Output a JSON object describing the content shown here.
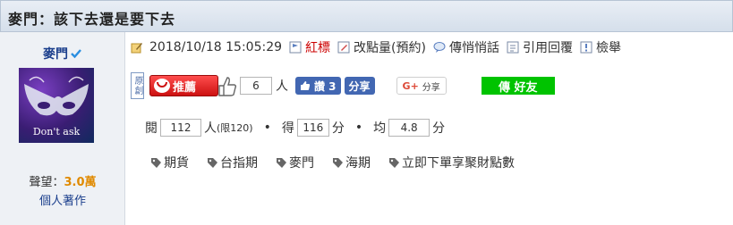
{
  "thread": {
    "title": "麥門：該下去還是要下去"
  },
  "author": {
    "name": "麥門",
    "avatar_caption": "Don't ask",
    "prestige_label": "聲望：",
    "prestige_value": "3.0萬",
    "works_link": "個人著作"
  },
  "post_meta": {
    "datetime": "2018/10/18 15:05:29",
    "actions": [
      "紅標",
      "改點量(預約)",
      "傳悄悄話",
      "引用回覆",
      "檢舉"
    ]
  },
  "buttons": {
    "original_label": "原創",
    "recommend_label": "推薦",
    "recommend_count": "6",
    "recommend_unit": "人",
    "fb_like_label": "讚 3",
    "fb_share_label": "分享",
    "g_share_label": "分享",
    "line_share_label": "傳 好友"
  },
  "stats": {
    "read_label": "閱",
    "read_value": "112",
    "read_unit": "人",
    "read_limit": "(限120)",
    "score_label": "得",
    "score_value": "116",
    "score_unit": "分",
    "avg_label": "均",
    "avg_value": "4.8",
    "avg_unit": "分"
  },
  "tags": [
    "期貨",
    "台指期",
    "麥門",
    "海期",
    "立即下單享聚財點數"
  ],
  "colors": {
    "title_bar": "#d5dfeb",
    "author_link": "#1a3e8c",
    "red_mark": "#cc0000",
    "prestige": "#e08a00",
    "fb_blue": "#4267b2",
    "line_green": "#00c300"
  },
  "icons": [
    "verified-check-icon",
    "edit-icon",
    "flag-icon",
    "chat-icon",
    "quote-icon",
    "report-icon",
    "thumb-up-icon",
    "tag-icon"
  ]
}
